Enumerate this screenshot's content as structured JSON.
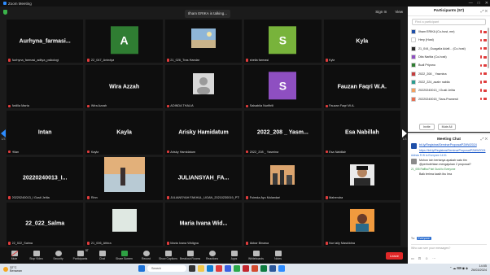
{
  "window": {
    "title": "Zoom Meeting",
    "controls": [
      "—",
      "□",
      "✕"
    ]
  },
  "meeting": {
    "talking": "Ilham ERIKA is talking...",
    "top_right": [
      "Sign In",
      "View"
    ],
    "page_left": "1/3",
    "page_right": "1/3",
    "tiles": [
      {
        "type": "name",
        "display": "Aurhyna_farmasi...",
        "label": "Aurhyna_farmasi_aditya_psikologi"
      },
      {
        "type": "letter",
        "letter": "A",
        "bg": "#2f7d32",
        "label": "22_047_Anindya"
      },
      {
        "type": "photo",
        "photo": "photo-beach",
        "label": "21_026_Tras Handar"
      },
      {
        "type": "letter",
        "letter": "S",
        "bg": "#78b33b",
        "label": "sheila farmasi"
      },
      {
        "type": "name",
        "display": "Kyla",
        "label": "Kyla"
      },
      {
        "type": "blank",
        "label": "Ardilla Marta"
      },
      {
        "type": "name",
        "display": "Wira Azzah",
        "label": "Wira Azzah"
      },
      {
        "type": "photo",
        "photo": "photo-default-avatar",
        "label": "ADINDA THALIA"
      },
      {
        "type": "letter",
        "letter": "S",
        "bg": "#8e4fc1",
        "label": "Salsabila Nurfitrili"
      },
      {
        "type": "name",
        "display": "Fauzan Faqri W.A.",
        "label": "Fauzan Faqri W.A."
      },
      {
        "type": "name",
        "display": "Intan",
        "label": "Hilan"
      },
      {
        "type": "name",
        "display": "Kayla",
        "label": "Kayla"
      },
      {
        "type": "name",
        "display": "Arisky Hamidatum",
        "label": "Arisky Hamidatum"
      },
      {
        "type": "name",
        "display": "2022_208 _ Yasm...",
        "label": "2022_208 _ Yasmina"
      },
      {
        "type": "name",
        "display": "Esa Nabillah",
        "label": "Esa Nabillah"
      },
      {
        "type": "name",
        "display": "20220240013_I...",
        "label": "20220240013_I Gusti Jelita"
      },
      {
        "type": "photo",
        "photo": "photo-sunset",
        "label": "Rinn"
      },
      {
        "type": "name",
        "display": "JULIANSYAH_FA...",
        "label": "JULIANSYAH FAKHUL_UGAN_20210230019_PTIK"
      },
      {
        "type": "photo",
        "photo": "photo-city",
        "label": "Fuimda Ayu Mulandari"
      },
      {
        "type": "photo",
        "photo": "photo-man",
        "label": "Mahendra"
      },
      {
        "type": "name",
        "display": "22_022_Salma",
        "label": "22_022_Salma"
      },
      {
        "type": "photo",
        "photo": "photo-light",
        "label": "21_006_Athira"
      },
      {
        "type": "name",
        "display": "Maria Ivana Wid...",
        "label": "Maria Ivana Widigna"
      },
      {
        "type": "blank",
        "label": "Akbar Binawa"
      },
      {
        "type": "photo",
        "photo": "photo-woman",
        "label": "Nur laily Masklidna"
      }
    ]
  },
  "toolbar": {
    "items": [
      {
        "label": "Mute",
        "icon": "mic-muted-icon",
        "style": "red"
      },
      {
        "label": "Stop Video",
        "icon": "video-icon",
        "style": ""
      },
      {
        "label": "Security",
        "icon": "shield-icon",
        "style": "round"
      },
      {
        "label": "Participants",
        "icon": "participants-icon",
        "style": "",
        "badge": "57"
      },
      {
        "label": "Chat",
        "icon": "chat-icon",
        "style": ""
      },
      {
        "label": "Share Screen",
        "icon": "share-screen-icon",
        "style": "green"
      },
      {
        "label": "Record",
        "icon": "record-icon",
        "style": "round"
      },
      {
        "label": "Show Captions",
        "icon": "captions-icon",
        "style": ""
      },
      {
        "label": "Breakout Rooms",
        "icon": "breakout-icon",
        "style": ""
      },
      {
        "label": "Reactions",
        "icon": "reactions-icon",
        "style": "round"
      },
      {
        "label": "Apps",
        "icon": "apps-icon",
        "style": ""
      },
      {
        "label": "Whiteboards",
        "icon": "whiteboard-icon",
        "style": ""
      },
      {
        "label": "Notes",
        "icon": "notes-icon",
        "style": ""
      }
    ],
    "end": "Leave"
  },
  "participants": {
    "title": "Participants (57)",
    "search_placeholder": "Find a participant",
    "list": [
      {
        "name": "Ilham ERIKA (Co-host, me)",
        "color": "#1f4fa8"
      },
      {
        "name": "Hery (Host)",
        "color": "#ffffff"
      },
      {
        "name": "21_044_Guagalla Adafi... (Co-host)",
        "color": "#2a2a2a"
      },
      {
        "name": "Dita Narlita (Co-host)",
        "color": "#8e4fc1"
      },
      {
        "name": "Budi Priyono",
        "color": "#2f7d32"
      },
      {
        "name": "2022_208 _ Yasmina",
        "color": "#c43c3c"
      },
      {
        "name": "2022_224_azahr nabila",
        "color": "#2a9d8f"
      },
      {
        "name": "20220240013_I Gusti Jelita",
        "color": "#f4a261"
      },
      {
        "name": "20220240015_Tiara-Pramesti",
        "color": "#e76f51"
      }
    ],
    "invite": "Invite",
    "mute_all": "Mute All"
  },
  "chat": {
    "title": "Meeting Chat",
    "messages": [
      {
        "kind": "link",
        "text": "bit.ly/RegistrasiSeminarProposalP2MW2024",
        "avatar": "#1f4fa8"
      },
      {
        "kind": "link",
        "text": "https://bit.ly/RegistrasiSeminarProposalP2MW2024",
        "avatar": ""
      },
      {
        "kind": "meta",
        "text": "Adinda R W to Everyone 14:51"
      },
      {
        "kind": "text",
        "text": "Mohon izin bertanya apakah satu tim @perbolehkan mengajukan 2 proposal?",
        "avatar": "#8a8a8a"
      },
      {
        "kind": "meta-green",
        "text": "21_055 Raffka Putri Gusti to Everyone"
      },
      {
        "kind": "plain",
        "text": "Baik terima kasih ibu Ima"
      }
    ],
    "to_label": "To:",
    "to_value": "Everyone",
    "input_placeholder": "Who can see your messages?"
  },
  "taskbar": {
    "temp": "32°C",
    "weather": "Berawan",
    "search_placeholder": "Search",
    "time": "14:55",
    "date": "26/03/2024"
  }
}
